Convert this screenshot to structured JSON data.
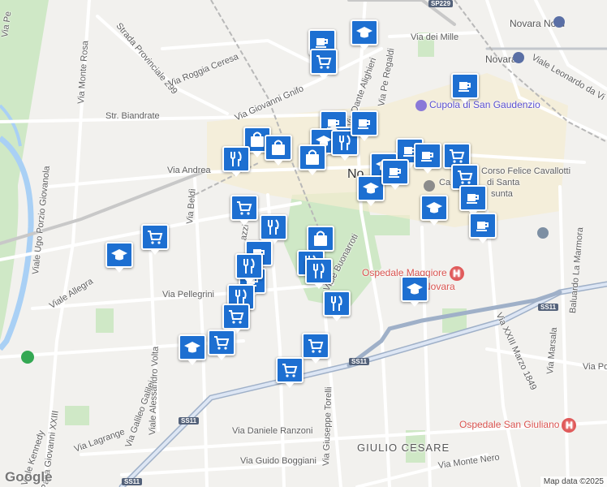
{
  "colors": {
    "marker": "#1d6fd1",
    "road": "#ffffff",
    "main_road": "#9fb0c8",
    "park": "#cfe8c6",
    "river": "#a9d0f5"
  },
  "streets": [
    {
      "id": "via-dei-mille",
      "text": "Via dei Mille"
    },
    {
      "id": "strada-prov",
      "text": "Strada Provinciale 299"
    },
    {
      "id": "via-monte-rosa",
      "text": "Via Monte Rosa"
    },
    {
      "id": "via-roggia-ceresa",
      "text": "Via Roggia Ceresa"
    },
    {
      "id": "via-giovanni-gnifo",
      "text": "Via Giovanni Gnifo"
    },
    {
      "id": "via-dante-alighieri",
      "text": "Via Dante Alighieri"
    },
    {
      "id": "via-pe-regaldi",
      "text": "Via Pe Regaldi"
    },
    {
      "id": "str-biandrate",
      "text": "Str. Biandrate"
    },
    {
      "id": "via-andrea",
      "text": "Via Andrea"
    },
    {
      "id": "via-beldi",
      "text": "Via Beldì"
    },
    {
      "id": "viale-allegra",
      "text": "Viale Allegra"
    },
    {
      "id": "via-pellegrini",
      "text": "Via Pellegrini"
    },
    {
      "id": "viale-alessandro-volta",
      "text": "Viale Alessandro Volta"
    },
    {
      "id": "via-galileo-galilei",
      "text": "Via Galileo Galilei"
    },
    {
      "id": "via-lagrange",
      "text": "Via Lagrange"
    },
    {
      "id": "viale-kennedy",
      "text": "Viale Kennedy"
    },
    {
      "id": "via-giovanni-xxiii",
      "text": "Papa Giovanni XXIII"
    },
    {
      "id": "viale-ugo-porzio",
      "text": "Viale Ugo Porzio Giovanola"
    },
    {
      "id": "via-daniele-ranzoni",
      "text": "Via Daniele Ranzoni"
    },
    {
      "id": "via-giuseppe-torelli",
      "text": "Via Giuseppe Torelli"
    },
    {
      "id": "via-guido-boggiani",
      "text": "Via Guido Boggiani"
    },
    {
      "id": "giulio-cesare",
      "text": "GIULIO CESARE"
    },
    {
      "id": "via-monte-nero",
      "text": "Via Monte Nero"
    },
    {
      "id": "via-marsala",
      "text": "Via Marsala"
    },
    {
      "id": "corso-felice-cavallotti",
      "text": "Corso Felice Cavallotti"
    },
    {
      "id": "baluardo-la-marmora",
      "text": "Baluardo La Marmora"
    },
    {
      "id": "viale-leonardo-da-vinci",
      "text": "Viale Leonardo da Vi"
    },
    {
      "id": "via-xxiii-marzo",
      "text": "Via XXIII Marzo 1849"
    },
    {
      "id": "viale-buonarroti",
      "text": "Viale Buonarroti"
    },
    {
      "id": "via-po",
      "text": "Via Po"
    },
    {
      "id": "via-pe",
      "text": "Via Pe"
    },
    {
      "id": "novara",
      "text": "Novara"
    },
    {
      "id": "novara-nord",
      "text": "Novara Nord"
    },
    {
      "id": "no-label",
      "text": "No"
    },
    {
      "id": "ca-label",
      "text": "Ca"
    },
    {
      "id": "santa-label",
      "text": "di Santa"
    },
    {
      "id": "sunta-label",
      "text": "sunta"
    },
    {
      "id": "azzi-label",
      "text": "azzi"
    }
  ],
  "pois": [
    {
      "id": "cupola",
      "text": "Cupola di San Gaudenzio"
    }
  ],
  "hospitals": [
    {
      "id": "ospedale-maggiore",
      "text": "Ospedale Maggiore",
      "text2": "Novara",
      "symbol": "H"
    },
    {
      "id": "ospedale-san-giuliano",
      "text": "Ospedale San Giuliano",
      "symbol": "H"
    }
  ],
  "highways": [
    {
      "id": "ss11-a",
      "text": "SS11"
    },
    {
      "id": "ss11-b",
      "text": "SS11"
    },
    {
      "id": "ss11-c",
      "text": "SS11"
    },
    {
      "id": "ss11-d",
      "text": "SS11"
    },
    {
      "id": "sp229",
      "text": "SP229"
    }
  ],
  "markers": [
    {
      "id": "m1",
      "icon": "cafe-icon"
    },
    {
      "id": "m2",
      "icon": "school-icon"
    },
    {
      "id": "m3",
      "icon": "grocery-icon"
    },
    {
      "id": "m4",
      "icon": "cafe-icon"
    },
    {
      "id": "m5",
      "icon": "cafe-icon"
    },
    {
      "id": "m6",
      "icon": "restaurant-icon"
    },
    {
      "id": "m7",
      "icon": "school-icon"
    },
    {
      "id": "m8",
      "icon": "shopping-bag-icon"
    },
    {
      "id": "m9",
      "icon": "shopping-bag-icon"
    },
    {
      "id": "m10",
      "icon": "restaurant-icon"
    },
    {
      "id": "m11",
      "icon": "shopping-bag-icon"
    },
    {
      "id": "m12",
      "icon": "restaurant-icon"
    },
    {
      "id": "m13",
      "icon": "cafe-icon"
    },
    {
      "id": "m14",
      "icon": "cafe-icon"
    },
    {
      "id": "m15",
      "icon": "grocery-icon"
    },
    {
      "id": "m16",
      "icon": "school-icon"
    },
    {
      "id": "m17",
      "icon": "grocery-icon"
    },
    {
      "id": "m18",
      "icon": "cafe-icon"
    },
    {
      "id": "m19",
      "icon": "school-icon"
    },
    {
      "id": "m20",
      "icon": "cafe-icon"
    },
    {
      "id": "m21",
      "icon": "grocery-icon"
    },
    {
      "id": "m22",
      "icon": "restaurant-icon"
    },
    {
      "id": "m23",
      "icon": "grocery-icon"
    },
    {
      "id": "m24",
      "icon": "school-icon"
    },
    {
      "id": "m25",
      "icon": "shopping-bag-icon"
    },
    {
      "id": "m26",
      "icon": "restaurant-icon"
    },
    {
      "id": "m27",
      "icon": "restaurant-icon"
    },
    {
      "id": "m28",
      "icon": "cafe-icon"
    },
    {
      "id": "m29",
      "icon": "cafe-icon"
    },
    {
      "id": "m30",
      "icon": "restaurant-icon"
    },
    {
      "id": "m31",
      "icon": "grocery-icon"
    },
    {
      "id": "m32",
      "icon": "school-icon"
    },
    {
      "id": "m33",
      "icon": "grocery-icon"
    },
    {
      "id": "m34",
      "icon": "grocery-icon"
    },
    {
      "id": "m35",
      "icon": "grocery-icon"
    },
    {
      "id": "m36",
      "icon": "school-icon"
    },
    {
      "id": "m37",
      "icon": "restaurant-icon"
    },
    {
      "id": "m38",
      "icon": "restaurant-icon"
    },
    {
      "id": "m39",
      "icon": "cafe-icon"
    },
    {
      "id": "m40",
      "icon": "cafe-icon"
    }
  ],
  "logo": "Google",
  "attribution": "Map data ©2025"
}
